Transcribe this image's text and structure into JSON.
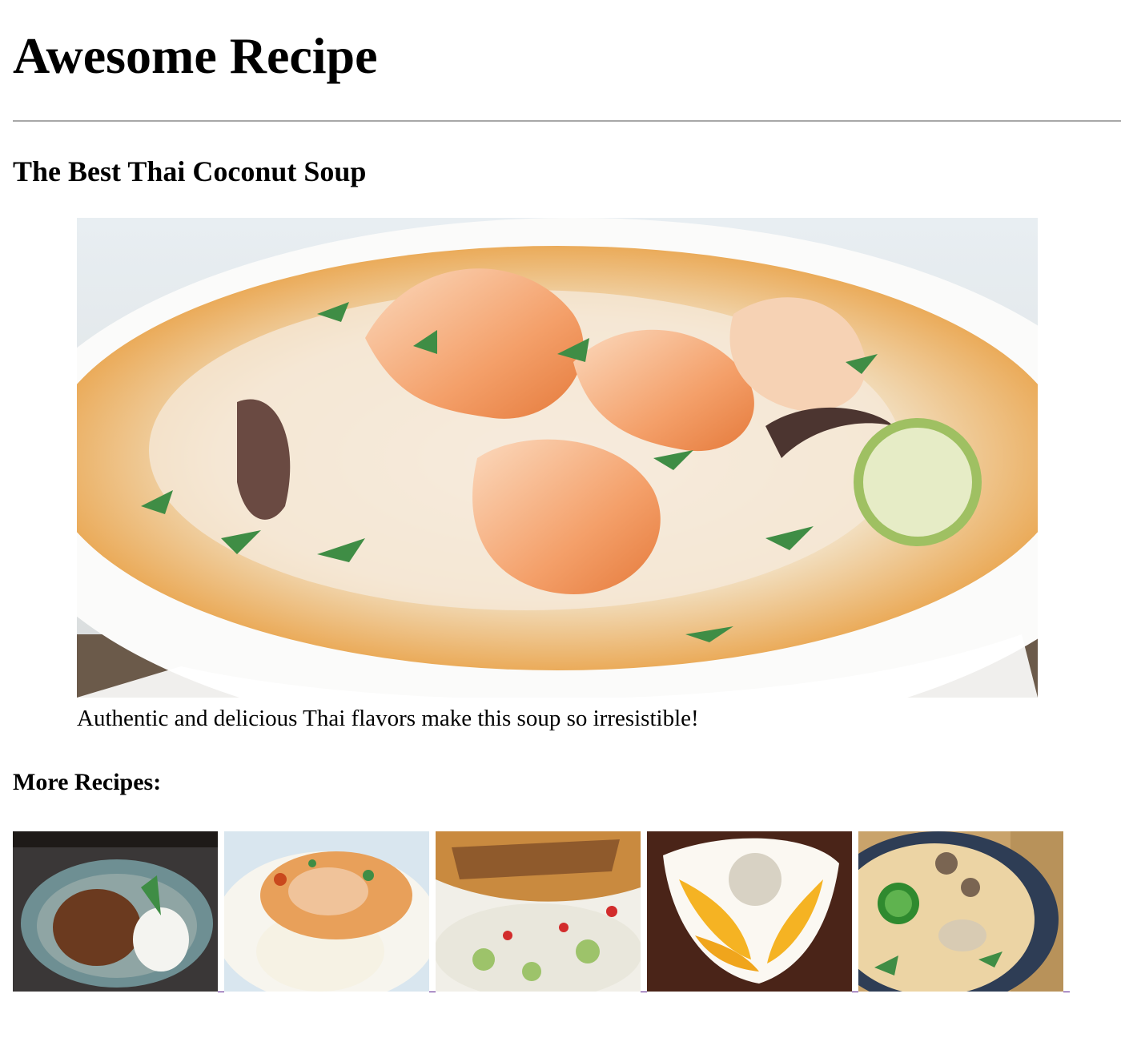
{
  "site": {
    "title": "Awesome Recipe"
  },
  "recipe": {
    "title": "The Best Thai Coconut Soup",
    "image_alt": "Thai coconut soup with shrimp, cilantro and lime",
    "caption": "Authentic and delicious Thai flavors make this soup so irresistible!"
  },
  "more": {
    "heading": "More Recipes:",
    "items": [
      {
        "alt": "Thai basil minced meat with rice"
      },
      {
        "alt": "Chicken curry over rice"
      },
      {
        "alt": "Grilled chicken satay with cucumber salad"
      },
      {
        "alt": "Mango sticky rice"
      },
      {
        "alt": "Coconut soup with jalapeño and mushrooms"
      }
    ]
  },
  "colors": {
    "rule": "#a8a8a8",
    "visited_link": "#551a8b",
    "soup_broth": "#f3e3c8",
    "soup_chili": "#e8922e"
  }
}
